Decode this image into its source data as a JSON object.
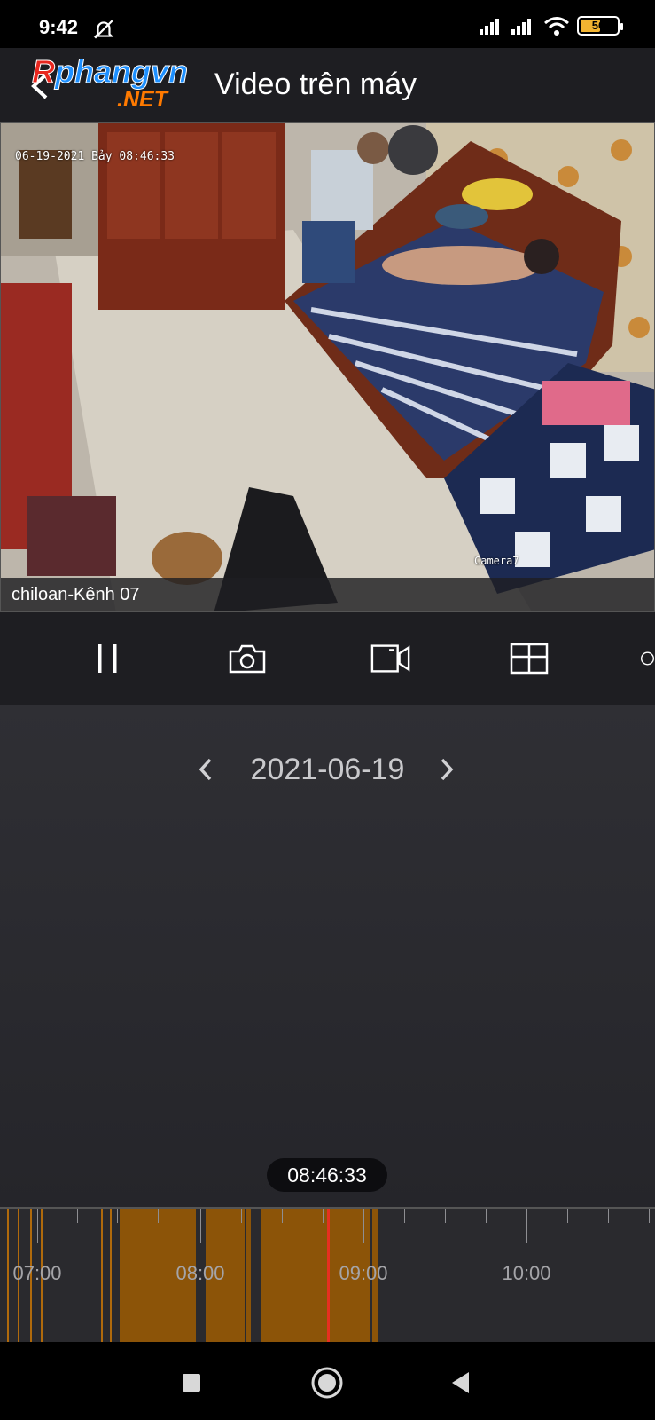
{
  "status": {
    "time": "9:42",
    "battery": "56",
    "battery_level": 0.56
  },
  "header": {
    "logo_main": "Rphangvn",
    "logo_sub": ".NET",
    "title": "Video trên máy"
  },
  "video": {
    "osd_text": "06-19-2021 Bảy 08:46:33",
    "camera_tag": "Camera7",
    "channel_label": "chiloan-Kênh 07"
  },
  "toolbar": {
    "icons": [
      "pause-icon",
      "snapshot-icon",
      "record-icon",
      "grid-icon"
    ]
  },
  "date_nav": {
    "date": "2021-06-19"
  },
  "playback": {
    "current_time": "08:46:33"
  },
  "timeline": {
    "labels": [
      "07:00",
      "08:00",
      "09:00",
      "10:00"
    ]
  },
  "colors": {
    "accent": "#8c5408",
    "cursor": "#e63020",
    "background": "#2f2f34"
  }
}
